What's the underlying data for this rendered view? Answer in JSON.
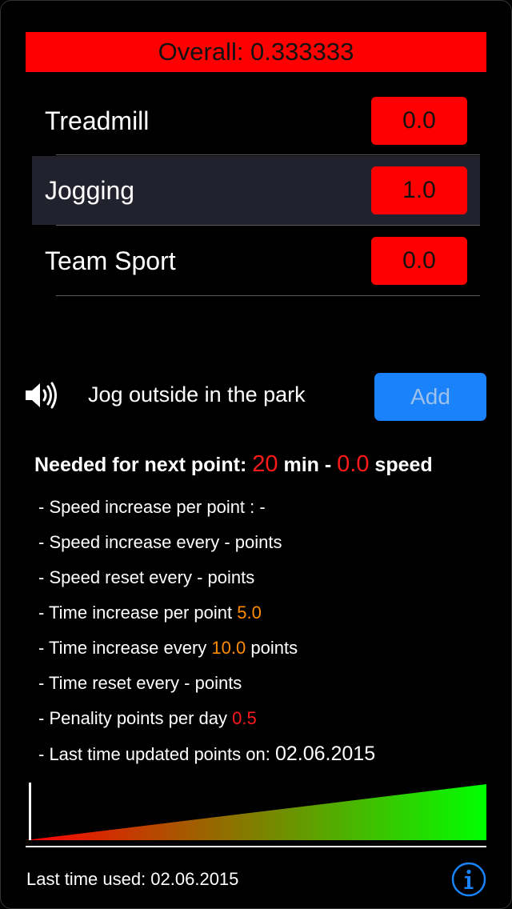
{
  "overall": {
    "text": "Overall: 0.333333"
  },
  "activities": [
    {
      "name": "Treadmill",
      "value": "0.0",
      "selected": false
    },
    {
      "name": "Jogging",
      "value": "1.0",
      "selected": true
    },
    {
      "name": "Team Sport",
      "value": "0.0",
      "selected": false
    }
  ],
  "current_activity": {
    "label": "Jog outside in the park",
    "add_label": "Add",
    "speaker_icon": "speaker-icon"
  },
  "needed": {
    "prefix": "Needed for next point:",
    "minutes": "20",
    "min_label": "min -",
    "speed": "0.0",
    "speed_label": "speed"
  },
  "rules": {
    "speed_increase_per_point": "- Speed increase per point : -",
    "speed_increase_every": "- Speed increase every - points",
    "speed_reset_every": "- Speed reset every - points",
    "time_increase_per_point_prefix": "- Time increase per point",
    "time_increase_per_point_value": "5.0",
    "time_increase_every_prefix": "- Time increase every",
    "time_increase_every_value": "10.0",
    "time_increase_every_suffix": "points",
    "time_reset_every": "- Time reset every - points",
    "penality_prefix": "- Penality points per day",
    "penality_value": "0.5",
    "last_updated_prefix": "- Last time updated points on:",
    "last_updated_date": "02.06.2015"
  },
  "gauge": {
    "level": 0.0,
    "start_color": "#ff0000",
    "end_color": "#00ff00"
  },
  "footer": {
    "last_used": "Last time used: 02.06.2015",
    "info_icon": "info-icon"
  },
  "colors": {
    "accent_red": "#ff0000",
    "button_blue": "#1a82fb",
    "highlight_orange": "#ff8c00"
  }
}
